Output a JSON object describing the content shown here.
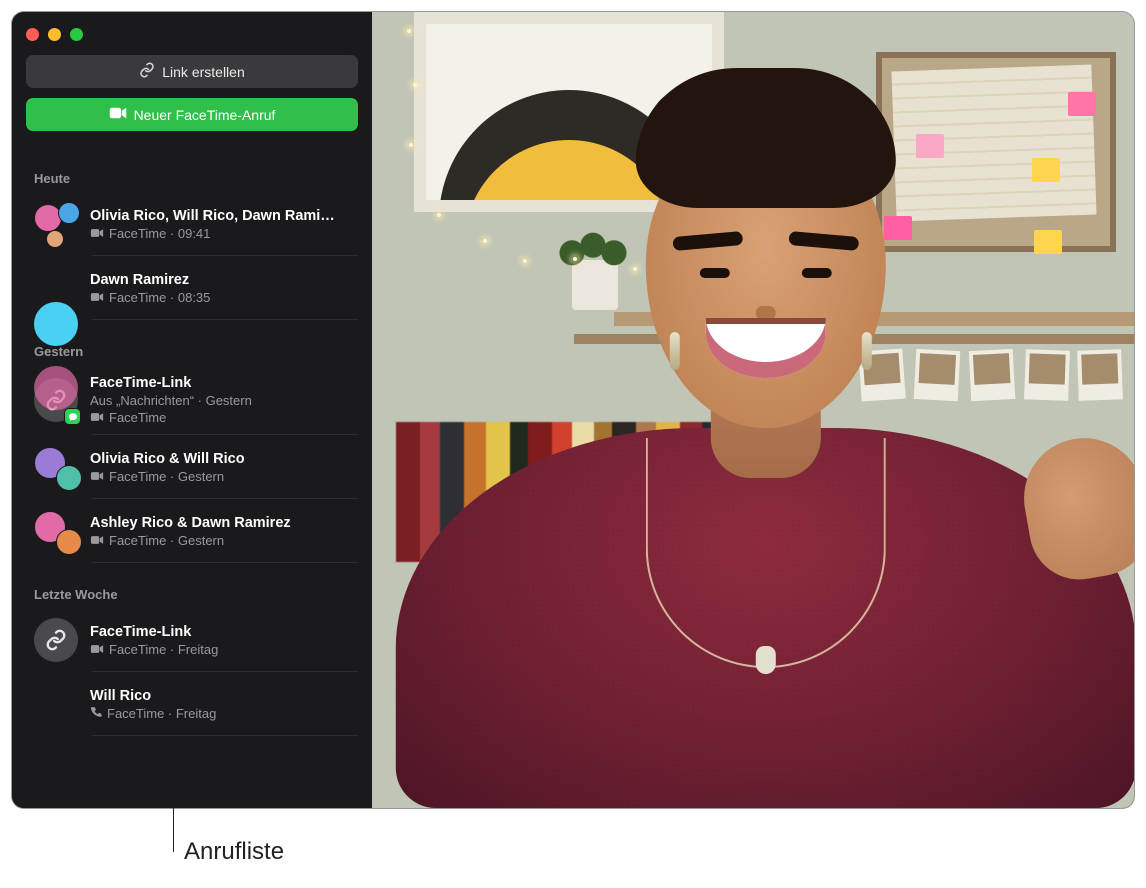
{
  "buttons": {
    "create_link": "Link erstellen",
    "new_call": "Neuer FaceTime-Anruf"
  },
  "sections": {
    "today": "Heute",
    "yesterday": "Gestern",
    "last_week": "Letzte Woche"
  },
  "calls": {
    "today": [
      {
        "title": "Olivia Rico, Will Rico, Dawn Rami…",
        "sub": "FaceTime · 09:41",
        "type": "video"
      },
      {
        "title": "Dawn Ramirez",
        "sub": "FaceTime · 08:35",
        "type": "video"
      }
    ],
    "yesterday": [
      {
        "title": "FaceTime-Link",
        "sub": "Aus „Nachrichten“ · Gestern",
        "sub2": "FaceTime",
        "type": "link"
      },
      {
        "title": "Olivia Rico & Will Rico",
        "sub": "FaceTime · Gestern",
        "type": "video"
      },
      {
        "title": "Ashley Rico & Dawn Ramirez",
        "sub": "FaceTime · Gestern",
        "type": "video"
      }
    ],
    "last_week": [
      {
        "title": "FaceTime-Link",
        "sub": "FaceTime · Freitag",
        "type": "link"
      },
      {
        "title": "Will Rico",
        "sub": "FaceTime · Freitag",
        "type": "audio"
      }
    ]
  },
  "callout": {
    "label": "Anrufliste"
  }
}
